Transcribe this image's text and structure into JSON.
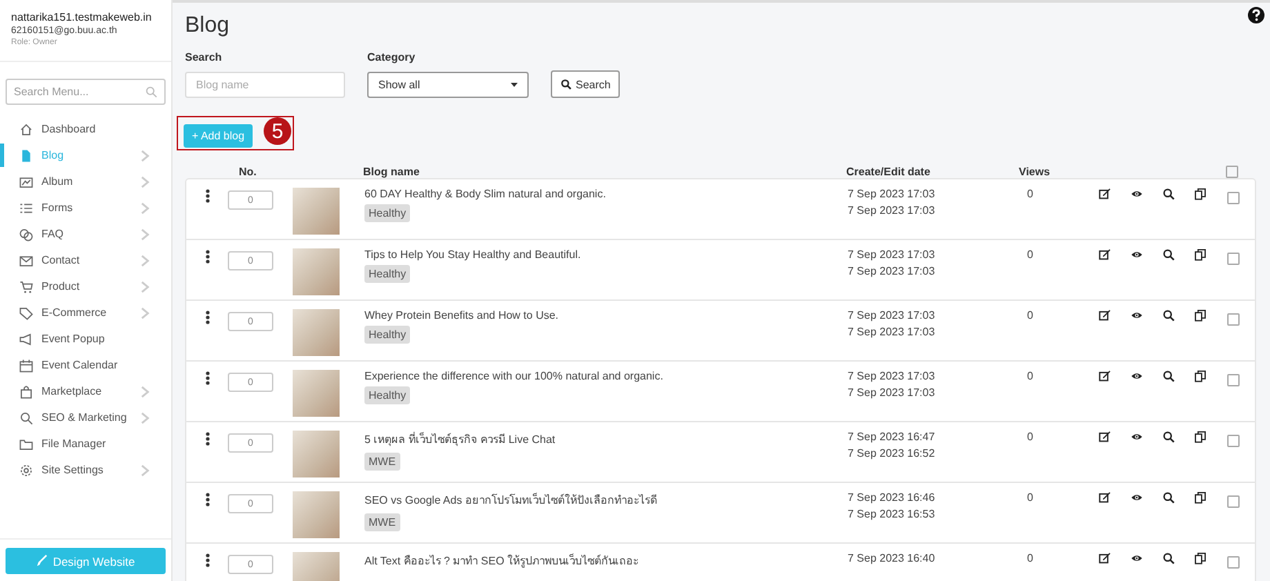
{
  "account": {
    "site": "nattarika151.testmakeweb.in",
    "email": "62160151@go.buu.ac.th",
    "role": "Role: Owner"
  },
  "sidebar": {
    "search_placeholder": "Search Menu...",
    "items": [
      {
        "label": "Dashboard",
        "has_submenu": false,
        "selected": false
      },
      {
        "label": "Blog",
        "has_submenu": true,
        "selected": true
      },
      {
        "label": "Album",
        "has_submenu": true,
        "selected": false
      },
      {
        "label": "Forms",
        "has_submenu": true,
        "selected": false
      },
      {
        "label": "FAQ",
        "has_submenu": true,
        "selected": false
      },
      {
        "label": "Contact",
        "has_submenu": true,
        "selected": false
      },
      {
        "label": "Product",
        "has_submenu": true,
        "selected": false
      },
      {
        "label": "E-Commerce",
        "has_submenu": true,
        "selected": false
      },
      {
        "label": "Event Popup",
        "has_submenu": false,
        "selected": false
      },
      {
        "label": "Event Calendar",
        "has_submenu": false,
        "selected": false
      },
      {
        "label": "Marketplace",
        "has_submenu": true,
        "selected": false
      },
      {
        "label": "SEO & Marketing",
        "has_submenu": true,
        "selected": false
      },
      {
        "label": "File Manager",
        "has_submenu": false,
        "selected": false
      },
      {
        "label": "Site Settings",
        "has_submenu": true,
        "selected": false
      }
    ],
    "design_button": "Design Website"
  },
  "page": {
    "title": "Blog",
    "search_label": "Search",
    "search_placeholder": "Blog name",
    "category_label": "Category",
    "category_value": "Show all",
    "search_button": "Search",
    "add_button": "+ Add blog",
    "annotation": "5"
  },
  "table": {
    "columns": [
      "No.",
      "Blog name",
      "Create/Edit date",
      "Views"
    ],
    "select_all_checked": false,
    "rows": [
      {
        "no": "0",
        "title": "60 DAY Healthy & Body Slim natural and organic.",
        "tag": "Healthy",
        "created": "7 Sep 2023 17:03",
        "edited": "7 Sep 2023 17:03",
        "views": "0",
        "checked": false
      },
      {
        "no": "0",
        "title": "Tips to Help You Stay Healthy and Beautiful.",
        "tag": "Healthy",
        "created": "7 Sep 2023 17:03",
        "edited": "7 Sep 2023 17:03",
        "views": "0",
        "checked": false
      },
      {
        "no": "0",
        "title": "Whey Protein Benefits and How to Use.",
        "tag": "Healthy",
        "created": "7 Sep 2023 17:03",
        "edited": "7 Sep 2023 17:03",
        "views": "0",
        "checked": false
      },
      {
        "no": "0",
        "title": "Experience the difference with our 100% natural and organic.",
        "tag": "Healthy",
        "created": "7 Sep 2023 17:03",
        "edited": "7 Sep 2023 17:03",
        "views": "0",
        "checked": false
      },
      {
        "no": "0",
        "title": "5 เหตุผล ที่เว็บไซต์ธุรกิจ ควรมี Live Chat",
        "tag": "MWE",
        "created": "7 Sep 2023 16:47",
        "edited": "7 Sep 2023 16:52",
        "views": "0",
        "checked": false
      },
      {
        "no": "0",
        "title": "SEO vs Google Ads อยากโปรโมทเว็บไซต์ให้ปังเลือกทำอะไรดี",
        "tag": "MWE",
        "created": "7 Sep 2023 16:46",
        "edited": "7 Sep 2023 16:53",
        "views": "0",
        "checked": false
      },
      {
        "no": "0",
        "title": "Alt Text คืออะไร ? มาทำ SEO ให้รูปภาพบนเว็บไซต์กันเถอะ",
        "created": "7 Sep 2023 16:40",
        "views": "0",
        "checked": false
      }
    ]
  }
}
